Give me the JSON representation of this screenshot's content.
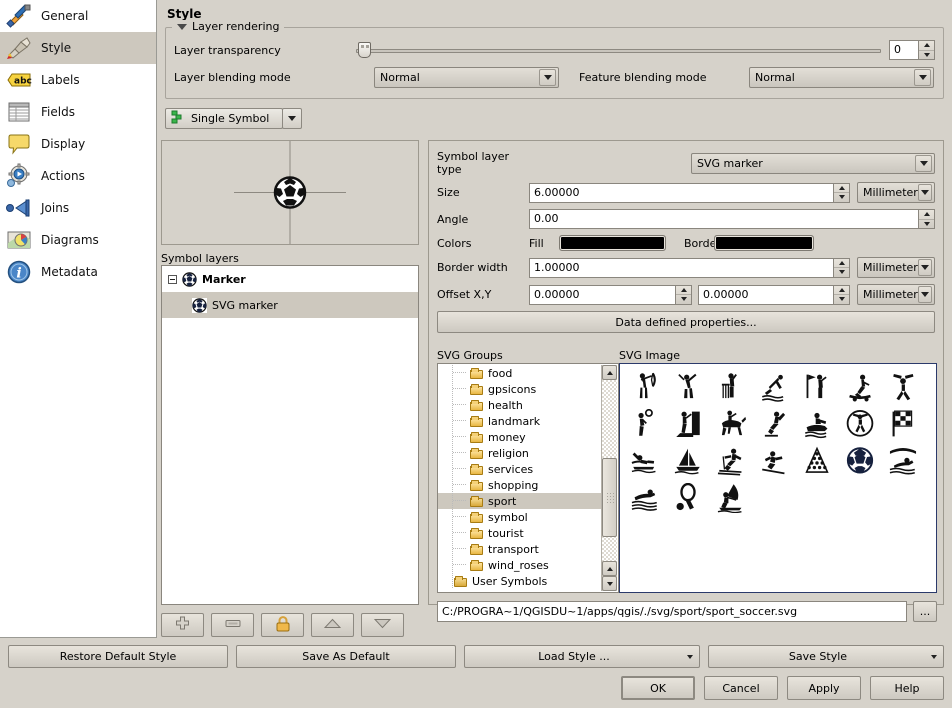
{
  "sidebar": {
    "items": [
      {
        "label": "General",
        "icon": "tools-icon",
        "selected": false
      },
      {
        "label": "Style",
        "icon": "brush-icon",
        "selected": true
      },
      {
        "label": "Labels",
        "icon": "abc-icon",
        "selected": false
      },
      {
        "label": "Fields",
        "icon": "table-icon",
        "selected": false
      },
      {
        "label": "Display",
        "icon": "callout-icon",
        "selected": false
      },
      {
        "label": "Actions",
        "icon": "gear-play-icon",
        "selected": false
      },
      {
        "label": "Joins",
        "icon": "join-arrow-icon",
        "selected": false
      },
      {
        "label": "Diagrams",
        "icon": "chart-map-icon",
        "selected": false
      },
      {
        "label": "Metadata",
        "icon": "info-icon",
        "selected": false
      }
    ]
  },
  "page": {
    "title": "Style"
  },
  "layer_rendering": {
    "group_title": "Layer rendering",
    "transparency_label": "Layer transparency",
    "transparency_value": "0",
    "blending_label": "Layer blending mode",
    "blending_value": "Normal",
    "feature_blending_label": "Feature blending mode",
    "feature_blending_value": "Normal"
  },
  "renderer": {
    "label": "Single Symbol",
    "icon": "single-symbol-icon"
  },
  "symbol_layers": {
    "label": "Symbol layers",
    "rows": [
      {
        "label": "Marker",
        "level": 0,
        "selected": false,
        "bold": true
      },
      {
        "label": "SVG marker",
        "level": 1,
        "selected": true,
        "bold": false
      }
    ],
    "buttons": [
      {
        "name": "add-symbol-layer-button",
        "icon": "plus-icon"
      },
      {
        "name": "remove-symbol-layer-button",
        "icon": "minus-icon"
      },
      {
        "name": "lock-symbol-layer-button",
        "icon": "lock-icon"
      },
      {
        "name": "move-up-button",
        "icon": "arrow-up-icon"
      },
      {
        "name": "move-down-button",
        "icon": "arrow-down-icon"
      }
    ]
  },
  "properties": {
    "symbol_layer_type_label": "Symbol layer type",
    "symbol_layer_type_value": "SVG marker",
    "size_label": "Size",
    "size_value": "6.00000",
    "size_unit": "Millimeter",
    "angle_label": "Angle",
    "angle_value": "0.00",
    "colors_label": "Colors",
    "fill_label": "Fill",
    "fill_color": "#000000",
    "border_label": "Border",
    "border_color": "#000000",
    "border_width_label": "Border width",
    "border_width_value": "1.00000",
    "border_width_unit": "Millimeter",
    "offset_label": "Offset X,Y",
    "offset_x_value": "0.00000",
    "offset_y_value": "0.00000",
    "offset_unit": "Millimeter",
    "data_defined_button": "Data defined properties..."
  },
  "svg_groups": {
    "label": "SVG Groups",
    "items": [
      {
        "label": "food",
        "selected": false
      },
      {
        "label": "gpsicons",
        "selected": false
      },
      {
        "label": "health",
        "selected": false
      },
      {
        "label": "landmark",
        "selected": false
      },
      {
        "label": "money",
        "selected": false
      },
      {
        "label": "religion",
        "selected": false
      },
      {
        "label": "services",
        "selected": false
      },
      {
        "label": "shopping",
        "selected": false
      },
      {
        "label": "sport",
        "selected": true
      },
      {
        "label": "symbol",
        "selected": false
      },
      {
        "label": "tourist",
        "selected": false
      },
      {
        "label": "transport",
        "selected": false
      },
      {
        "label": "wind_roses",
        "selected": false
      },
      {
        "label": "User Symbols",
        "selected": false,
        "root": true
      }
    ]
  },
  "svg_image": {
    "label": "SVG Image",
    "icons": [
      "archery",
      "baseball",
      "cricket",
      "diving",
      "golf",
      "skateboard",
      "gymnastics",
      "basketball",
      "climbing",
      "horse-riding",
      "ice-skating",
      "jet-ski",
      "leisure-centre",
      "motor-racing",
      "canoe",
      "sailing",
      "cross-country-ski",
      "downhill-ski",
      "snooker",
      "soccer",
      "swimming-indoor",
      "swimming-outdoor",
      "tennis",
      "windsurfing"
    ]
  },
  "svg_path": {
    "value": "C:/PROGRA~1/QGISDU~1/apps/qgis/./svg/sport/sport_soccer.svg",
    "browse_label": "..."
  },
  "bottom_bar": {
    "restore_default": "Restore Default Style",
    "save_as_default": "Save As Default",
    "load_style": "Load Style ...",
    "save_style": "Save Style",
    "ok": "OK",
    "cancel": "Cancel",
    "apply": "Apply",
    "help": "Help"
  }
}
